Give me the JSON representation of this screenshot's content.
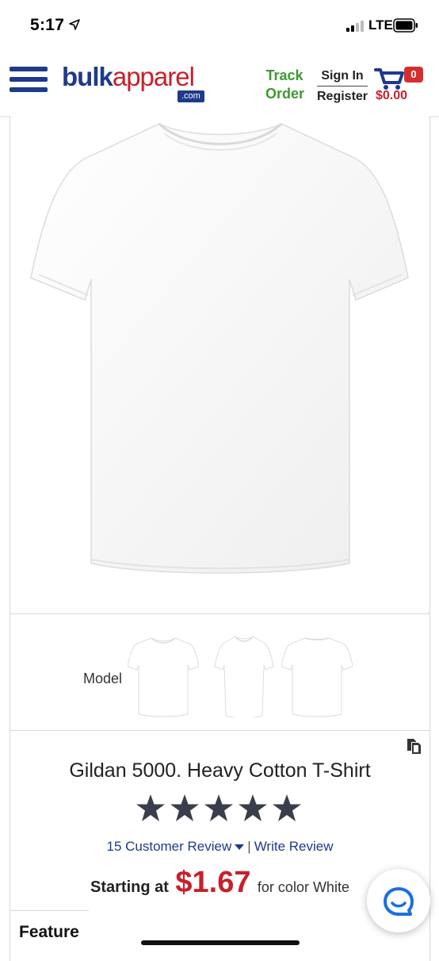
{
  "status_bar": {
    "time": "5:17",
    "network": "LTE"
  },
  "header": {
    "logo_part1": "bulk",
    "logo_part2": "apparel",
    "logo_domain": ".com",
    "track_line1": "Track",
    "track_line2": "Order",
    "sign_in": "Sign In",
    "register": "Register",
    "cart_count": "0",
    "cart_total": "$0.00"
  },
  "gallery": {
    "model_label": "Model"
  },
  "product": {
    "title": "Gildan 5000. Heavy Cotton T-Shirt",
    "rating_stars": 5,
    "review_count_label": "15 Customer Review",
    "review_separator": "|",
    "write_review_label": "Write Review",
    "starting_label": "Starting at",
    "price": "$1.67",
    "color_label": "for color White"
  },
  "sections": {
    "feature_label": "Feature"
  },
  "colors": {
    "brand_blue": "#1e3a8a",
    "brand_red": "#c8202a",
    "track_green": "#3c9a2f",
    "star_gray": "#3a3d4a",
    "chat_blue": "#1a6fe0"
  }
}
